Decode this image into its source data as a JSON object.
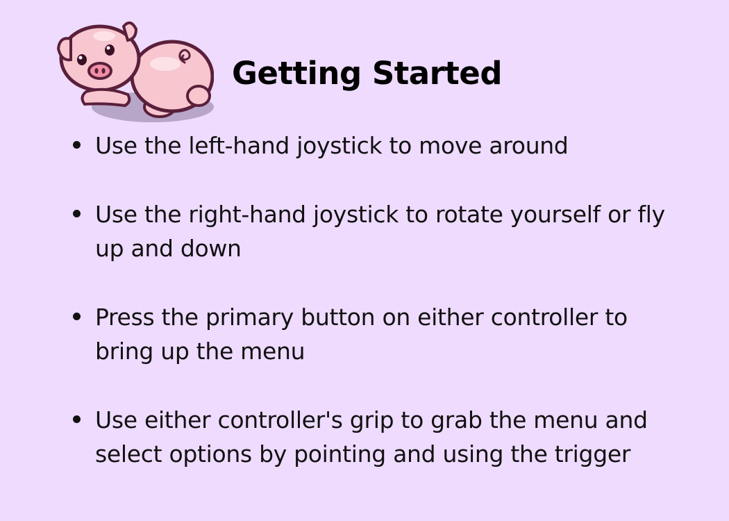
{
  "page": {
    "background": "#EEDBFE",
    "title": "Getting Started"
  },
  "illustration": {
    "icon": "sleeping-pig-icon",
    "body_color": "#F7C6CF",
    "outline_color": "#5A1F3A"
  },
  "tips": [
    {
      "text": "Use the left-hand joystick to move around"
    },
    {
      "text": "Use the right-hand joystick to rotate yourself or fly up and down"
    },
    {
      "text": "Press the primary button on either controller to bring up the menu"
    },
    {
      "text": "Use either controller's grip to grab the menu and select options by pointing and using the trigger"
    }
  ]
}
